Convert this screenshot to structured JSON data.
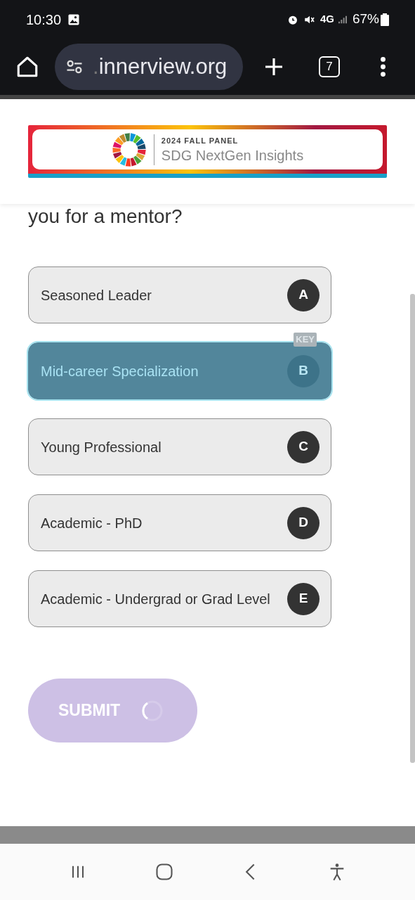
{
  "status_bar": {
    "time": "10:30",
    "network": "4G",
    "battery": "67%"
  },
  "browser": {
    "url_prefix": ".",
    "url": "innerview.org",
    "tab_count": "7"
  },
  "banner": {
    "kicker": "2024 FALL PANEL",
    "title": "SDG NextGen Insights"
  },
  "question_fragment": "you for a mentor?",
  "options": [
    {
      "label": "Seasoned Leader",
      "letter": "A",
      "selected": false
    },
    {
      "label": "Mid-career Specialization",
      "letter": "B",
      "selected": true,
      "badge": "KEY"
    },
    {
      "label": "Young Professional",
      "letter": "C",
      "selected": false
    },
    {
      "label": "Academic - PhD",
      "letter": "D",
      "selected": false
    },
    {
      "label": "Academic - Undergrad or Grad Level",
      "letter": "E",
      "selected": false
    }
  ],
  "submit": {
    "label": "SUBMIT",
    "loading": true
  }
}
